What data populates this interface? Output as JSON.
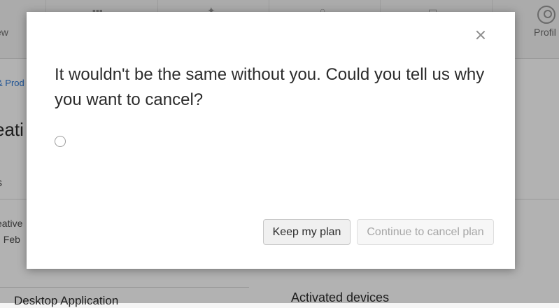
{
  "background": {
    "nav": {
      "left_label": "ew",
      "right_label": "Profil",
      "icons": [
        "grid-icon",
        "puzzle-icon",
        "search-icon",
        "chat-icon",
        "profile-icon"
      ]
    },
    "breadcrumb": "& Prod",
    "heading": "eati",
    "tab_label": "s",
    "info_line1": "eative",
    "info_line2": ": Feb",
    "bottom_left": "Desktop Application",
    "bottom_right": "Activated devices"
  },
  "modal": {
    "title": "It wouldn't be the same without you. Could you tell us why you want to cancel?",
    "keep_label": "Keep my plan",
    "continue_label": "Continue to cancel plan",
    "colors": {
      "continue_disabled_text": "#a6a6a6",
      "title_text": "#2c2c2c"
    }
  }
}
